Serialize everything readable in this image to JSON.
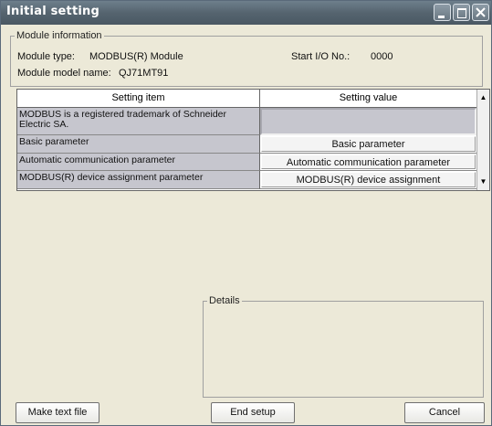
{
  "window": {
    "title": "Initial setting"
  },
  "module_info": {
    "legend": "Module information",
    "module_type_label": "Module type:",
    "module_type_value": "MODBUS(R) Module",
    "start_io_label": "Start I/O No.:",
    "start_io_value": "0000",
    "model_name_label": "Module model name:",
    "model_name_value": "QJ71MT91"
  },
  "table": {
    "headers": {
      "item": "Setting item",
      "value": "Setting value"
    },
    "rows": [
      {
        "item": "MODBUS is a registered trademark of Schneider Electric SA.",
        "value": ""
      },
      {
        "item": "Basic parameter",
        "value": "Basic parameter"
      },
      {
        "item": "Automatic communication parameter",
        "value": "Automatic communication parameter"
      },
      {
        "item": "MODBUS(R) device assignment parameter",
        "value": "MODBUS(R) device assignment"
      }
    ]
  },
  "details": {
    "legend": "Details"
  },
  "buttons": {
    "make_text_file": "Make text file",
    "end_setup": "End setup",
    "cancel": "Cancel"
  },
  "icons": {
    "minimize": "minimize-icon",
    "maximize": "maximize-icon",
    "close": "close-icon",
    "scroll_up": "scroll-up-arrow-icon",
    "scroll_down": "scroll-down-arrow-icon"
  },
  "colors": {
    "titlebar": "#55646f",
    "window_bg": "#ece9d8",
    "item_cell_bg": "#c6c6ce"
  }
}
